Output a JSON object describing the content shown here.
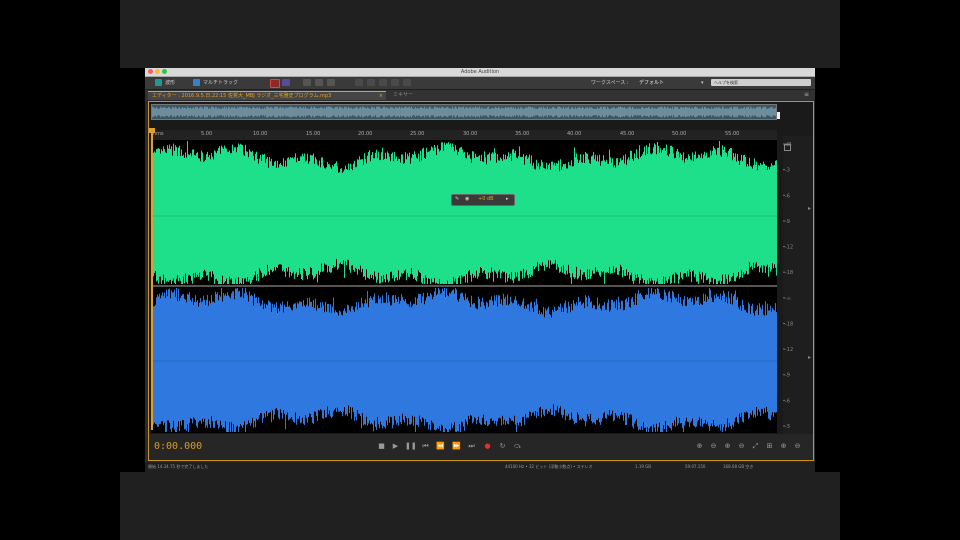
{
  "app": {
    "window_title": "Adobe Audition"
  },
  "toolbar": {
    "waveform_label": "波形",
    "multitrack_label": "マルチトラック",
    "workspace_label": "ワークスペース :",
    "workspace_value": "デフォルト",
    "search_placeholder": "ヘルプを検索"
  },
  "tabs": [
    {
      "label": "エディター : 2016.9.5.日.22:15 佐賀大_MBJ ラジオ_三宅雅史プログラム.mp3",
      "active": true
    },
    {
      "label": "ミキサー",
      "active": false
    }
  ],
  "ruler": {
    "labels": [
      "hms",
      "5.00",
      "10.00",
      "15.00",
      "20.00",
      "25.00",
      "30.00",
      "35.00",
      "40.00",
      "45.00",
      "50.00",
      "55.00"
    ]
  },
  "hud": {
    "value": "+0 dB"
  },
  "channels": [
    {
      "name": "left",
      "color": "#1fe08a"
    },
    {
      "name": "right",
      "color": "#2f78e0"
    }
  ],
  "db_scale": [
    "dB",
    "-3",
    "-6",
    "-9",
    "-12",
    "-18",
    "-∞",
    "-18",
    "-12",
    "-9",
    "-6",
    "-3"
  ],
  "transport": {
    "timecode": "0:00.000"
  },
  "status": {
    "left": "開始 14.34.75 秒で完了しました",
    "format": "44100 Hz • 32 ビット (浮動小数点) • ステレオ",
    "size": "1.19 GB",
    "duration": "59:07.150",
    "free": "168.08 GB 空き"
  }
}
